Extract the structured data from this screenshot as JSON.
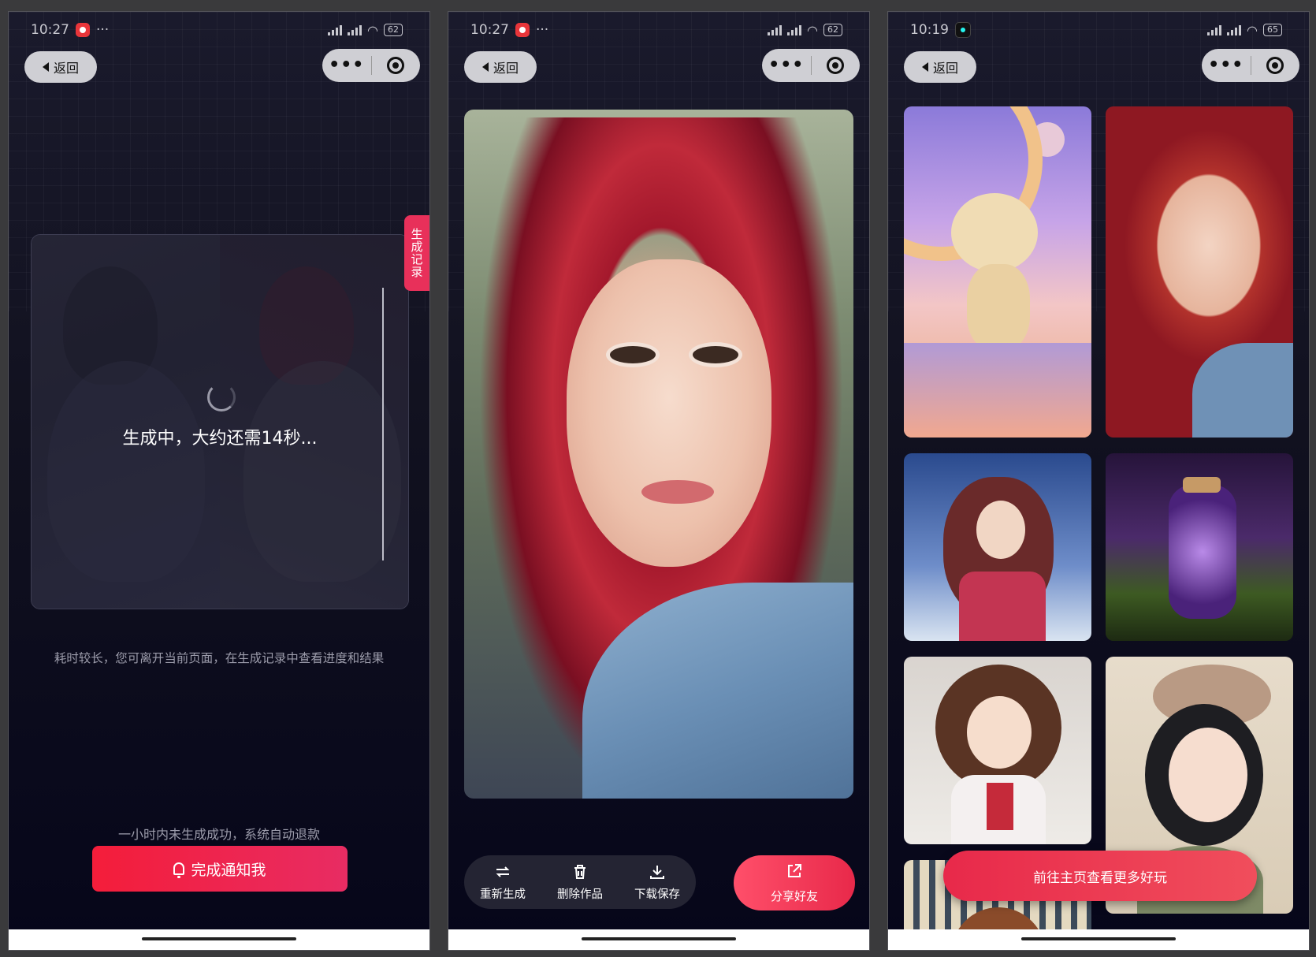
{
  "screens": [
    {
      "status": {
        "time": "10:27",
        "battery": "62"
      },
      "nav": {
        "back_label": "返回",
        "more_label": "•••"
      },
      "generating": {
        "record_tab_label": "生成记录",
        "progress_text": "生成中，大约还需14秒...",
        "hint_text": "耗时较长，您可离开当前页面，在生成记录中查看进度和结果",
        "refund_text": "一小时内未生成成功，系统自动退款",
        "notify_button": "完成通知我"
      }
    },
    {
      "status": {
        "time": "10:27",
        "battery": "62"
      },
      "nav": {
        "back_label": "返回",
        "more_label": "•••"
      },
      "result": {
        "actions": [
          {
            "label": "重新生成",
            "icon": "refresh-icon"
          },
          {
            "label": "删除作品",
            "icon": "trash-icon"
          },
          {
            "label": "下载保存",
            "icon": "download-icon"
          }
        ],
        "share_label": "分享好友",
        "share_icon": "share-icon"
      }
    },
    {
      "status": {
        "time": "10:19",
        "battery": "65"
      },
      "nav": {
        "back_label": "返回",
        "more_label": "•••"
      },
      "gallery": {
        "explore_button": "前往主页查看更多好玩"
      }
    }
  ],
  "colors": {
    "accent": "#e8294a",
    "record_tab": "#e8305a",
    "background_dark": "#0d0d1e"
  }
}
